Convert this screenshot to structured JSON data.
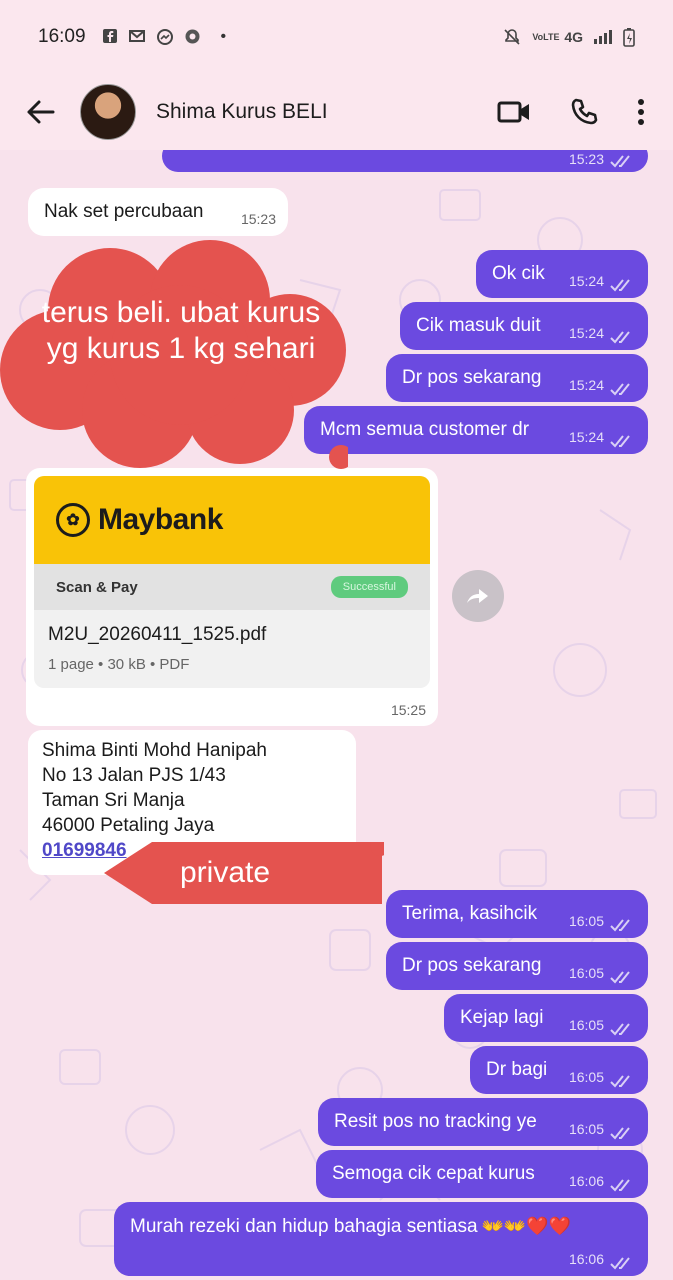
{
  "status_bar": {
    "time": "16:09",
    "left_icons": [
      "facebook-icon",
      "gmail-icon",
      "messenger-icon",
      "chrome-icon"
    ],
    "dot": "•",
    "network": "4G",
    "lte": "VoLTE"
  },
  "header": {
    "contact_name": "Shima Kurus BELI"
  },
  "annotations": {
    "cloud_text": "terus beli. ubat kurus yg kurus 1 kg sehari",
    "private_label": "private"
  },
  "messages": {
    "m0_time": "15:23",
    "m1_text": "Nak set percubaan",
    "m1_time": "15:23",
    "m2_text": "Ok cik",
    "m2_time": "15:24",
    "m3_text": "Cik masuk duit",
    "m3_time": "15:24",
    "m4_text": "Dr pos sekarang",
    "m4_time": "15:24",
    "m5_text": "Mcm semua customer dr",
    "m5_time": "15:24",
    "m7_text": "Terima, kasihcik",
    "m7_time": "16:05",
    "m8_text": "Dr pos sekarang",
    "m8_time": "16:05",
    "m9_text": "Kejap lagi",
    "m9_time": "16:05",
    "m10_text": "Dr bagi",
    "m10_time": "16:05",
    "m11_text": "Resit pos no tracking ye",
    "m11_time": "16:05",
    "m12_text": "Semoga cik cepat kurus",
    "m12_time": "16:06",
    "m13_text": "Murah rezeki dan hidup bahagia sentiasa",
    "m13_emoji": "👐👐❤️❤️",
    "m13_time": "16:06"
  },
  "document": {
    "brand": "Maybank",
    "scan_pay": "Scan & Pay",
    "status": "Successful",
    "filename": "M2U_20260411_1525.pdf",
    "meta": "1 page • 30 kB • PDF",
    "time": "15:25"
  },
  "address": {
    "line1": "Shima Binti Mohd Hanipah",
    "line2": "No 13 Jalan PJS 1/43",
    "line3": "Taman Sri Manja",
    "line4": "46000 Petaling Jaya",
    "phone_partial": "01699846"
  },
  "colors": {
    "outgoing_bubble": "#6b4ae0",
    "chat_background": "#f8e2ec",
    "annotation_red": "#e4534f",
    "maybank_yellow": "#f9c307"
  }
}
